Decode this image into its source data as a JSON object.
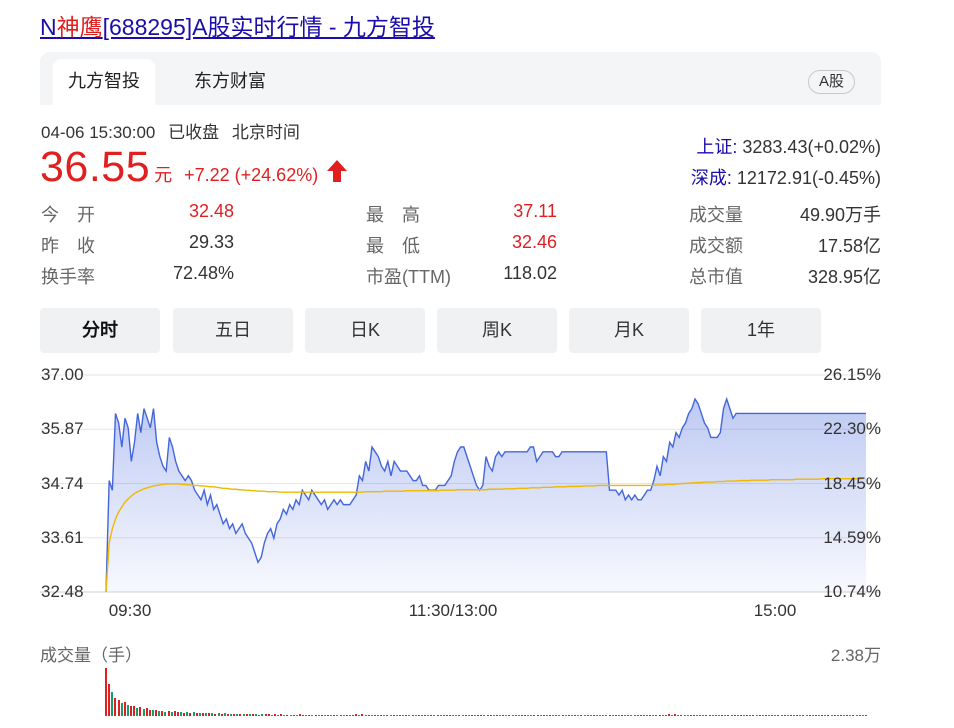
{
  "title": {
    "prefix": "N",
    "highlight": "神鹰",
    "suffix": "[688295]A股实时行情 - 九方智投"
  },
  "tabs": [
    {
      "label": "九方智投",
      "active": true
    },
    {
      "label": "东方财富",
      "active": false
    }
  ],
  "market_badge": "A股",
  "status": {
    "datetime": "04-06 15:30:00",
    "state": "已收盘",
    "timezone": "北京时间"
  },
  "quote": {
    "price": "36.55",
    "unit": "元",
    "change": "+7.22 (+24.62%)",
    "direction": "up"
  },
  "indices": [
    {
      "name": "上证:",
      "value": "3283.43(+0.02%)"
    },
    {
      "name": "深成:",
      "value": "12172.91(-0.45%)"
    }
  ],
  "stats": [
    [
      {
        "label": "今　开",
        "value": "32.48",
        "color": "red"
      },
      {
        "label": "最　高",
        "value": "37.11",
        "color": "red"
      },
      {
        "label": "成交量",
        "value": "49.90万手",
        "color": "dark"
      }
    ],
    [
      {
        "label": "昨　收",
        "value": "29.33",
        "color": "dark"
      },
      {
        "label": "最　低",
        "value": "32.46",
        "color": "red"
      },
      {
        "label": "成交额",
        "value": "17.58亿",
        "color": "dark"
      }
    ],
    [
      {
        "label": "换手率",
        "value": "72.48%",
        "color": "dark"
      },
      {
        "label": "市盈(TTM)",
        "value": "118.02",
        "color": "dark"
      },
      {
        "label": "总市值",
        "value": "328.95亿",
        "color": "dark"
      }
    ]
  ],
  "period_buttons": [
    {
      "label": "分时",
      "active": true
    },
    {
      "label": "五日",
      "active": false
    },
    {
      "label": "日K",
      "active": false
    },
    {
      "label": "周K",
      "active": false
    },
    {
      "label": "月K",
      "active": false
    },
    {
      "label": "1年",
      "active": false
    }
  ],
  "colors": {
    "up": "#e02020",
    "down": "#10a070",
    "price_line": "#4466dd",
    "avg_line": "#f0b800",
    "link": "#1a0dab"
  },
  "chart_data": {
    "type": "line",
    "y_ticks_left": [
      "37.00",
      "35.87",
      "34.74",
      "33.61",
      "32.48"
    ],
    "y_ticks_right": [
      "26.15%",
      "22.30%",
      "18.45%",
      "14.59%",
      "10.74%"
    ],
    "ylim": [
      32.48,
      37.0
    ],
    "x_ticks": [
      "09:30",
      "11:30/13:00",
      "15:00"
    ],
    "grid": true,
    "x": [
      0,
      1,
      2,
      3,
      4,
      5,
      6,
      7,
      8,
      9,
      10,
      11,
      12,
      13,
      14,
      15,
      16,
      17,
      18,
      19,
      20,
      21,
      22,
      23,
      24,
      25,
      26,
      27,
      28,
      29,
      30,
      31,
      32,
      33,
      34,
      35,
      36,
      37,
      38,
      39,
      40,
      41,
      42,
      43,
      44,
      45,
      46,
      47,
      48,
      49,
      50,
      51,
      52,
      53,
      54,
      55,
      56,
      57,
      58,
      59,
      60,
      61,
      62,
      63,
      64,
      65,
      66,
      67,
      68,
      69,
      70,
      71,
      72,
      73,
      74,
      75,
      76,
      77,
      78,
      79,
      80,
      81,
      82,
      83,
      84,
      85,
      86,
      87,
      88,
      89,
      90,
      91,
      92,
      93,
      94,
      95,
      96,
      97,
      98,
      99,
      100,
      101,
      102,
      103,
      104,
      105,
      106,
      107,
      108,
      109,
      110,
      111,
      112,
      113,
      114,
      115,
      116,
      117,
      118,
      119,
      120,
      121,
      122,
      123,
      124,
      125,
      126,
      127,
      128,
      129,
      130,
      131,
      132,
      133,
      134,
      135,
      136,
      137,
      138,
      139,
      140,
      141,
      142,
      143,
      144,
      145,
      146,
      147,
      148,
      149,
      150,
      151,
      152,
      153,
      154,
      155,
      156,
      157,
      158,
      159,
      160,
      161,
      162,
      163,
      164,
      165,
      166,
      167,
      168,
      169,
      170,
      171,
      172,
      173,
      174,
      175,
      176,
      177,
      178,
      179,
      180,
      181,
      182,
      183,
      184,
      185,
      186,
      187,
      188,
      189,
      190,
      191,
      192,
      193,
      194,
      195,
      196,
      197,
      198,
      199,
      200,
      201,
      202,
      203,
      204,
      205,
      206,
      207,
      208,
      209,
      210,
      211,
      212,
      213,
      214,
      215,
      216,
      217,
      218,
      219,
      220,
      221,
      222,
      223,
      224,
      225,
      226,
      227,
      228,
      229,
      230,
      231,
      232,
      233,
      234,
      235,
      236,
      237,
      238,
      239,
      240
    ],
    "series": [
      {
        "values": [
          32.48,
          34.8,
          34.6,
          36.2,
          36.0,
          35.5,
          36.1,
          35.9,
          35.2,
          35.6,
          36.2,
          35.8,
          36.3,
          36.1,
          35.9,
          36.3,
          35.6,
          35.3,
          35.1,
          35.0,
          35.7,
          35.5,
          35.2,
          35.0,
          34.9,
          34.8,
          34.9,
          34.8,
          34.6,
          34.5,
          34.4,
          34.6,
          34.3,
          34.5,
          34.2,
          34.3,
          34.1,
          33.9,
          34.0,
          33.8,
          33.9,
          33.7,
          33.8,
          33.9,
          33.7,
          33.6,
          33.5,
          33.3,
          33.1,
          33.2,
          33.5,
          33.7,
          33.8,
          33.6,
          33.9,
          34.0,
          34.2,
          34.1,
          34.3,
          34.2,
          34.4,
          34.3,
          34.6,
          34.5,
          34.4,
          34.6,
          34.5,
          34.4,
          34.3,
          34.4,
          34.2,
          34.3,
          34.4,
          34.3,
          34.4,
          34.3,
          34.3,
          34.3,
          34.4,
          34.5,
          34.9,
          34.8,
          35.2,
          35.0,
          35.5,
          35.4,
          35.3,
          35.1,
          35.0,
          35.2,
          34.9,
          35.2,
          35.1,
          35.0,
          35.0,
          35.0,
          34.9,
          34.8,
          34.8,
          34.9,
          34.7,
          34.7,
          34.6,
          34.6,
          34.6,
          34.7,
          34.7,
          34.7,
          34.8,
          34.9,
          35.2,
          35.4,
          35.5,
          35.5,
          35.3,
          35.1,
          34.9,
          34.7,
          34.6,
          34.7,
          35.3,
          35.1,
          35.0,
          35.3,
          35.4,
          35.3,
          35.4,
          35.4,
          35.4,
          35.4,
          35.4,
          35.4,
          35.4,
          35.4,
          35.5,
          35.5,
          35.2,
          35.3,
          35.4,
          35.4,
          35.4,
          35.4,
          35.3,
          35.3,
          35.4,
          35.4,
          35.4,
          35.4,
          35.4,
          35.4,
          35.4,
          35.4,
          35.4,
          35.4,
          35.4,
          35.4,
          35.4,
          35.4,
          35.4,
          34.6,
          34.6,
          34.6,
          34.5,
          34.6,
          34.4,
          34.5,
          34.4,
          34.5,
          34.4,
          34.4,
          34.5,
          34.6,
          34.6,
          34.8,
          35.1,
          34.9,
          35.3,
          35.2,
          35.6,
          35.5,
          35.8,
          35.7,
          35.9,
          36.0,
          36.2,
          36.3,
          36.5,
          36.4,
          36.2,
          36.0,
          35.9,
          35.7,
          35.7,
          35.7,
          35.8,
          36.3,
          36.5,
          36.3,
          36.1,
          36.2,
          36.2,
          36.2,
          36.2,
          36.2,
          36.2,
          36.2,
          36.2,
          36.2,
          36.2,
          36.2,
          36.2,
          36.2,
          36.2,
          36.2,
          36.2,
          36.2,
          36.2,
          36.2,
          36.2,
          36.2,
          36.2,
          36.2,
          36.2,
          36.2,
          36.2,
          36.2,
          36.2,
          36.2,
          36.2,
          36.2,
          36.2,
          36.2,
          36.2,
          36.2,
          36.2,
          36.2,
          36.2,
          36.2,
          36.2,
          36.2,
          36.2
        ]
      },
      {
        "values": [
          32.48,
          33.5,
          33.8,
          34.0,
          34.15,
          34.25,
          34.35,
          34.42,
          34.48,
          34.53,
          34.57,
          34.6,
          34.63,
          34.65,
          34.67,
          34.69,
          34.7,
          34.71,
          34.72,
          34.73,
          34.73,
          34.73,
          34.73,
          34.73,
          34.72,
          34.72,
          34.71,
          34.71,
          34.7,
          34.7,
          34.69,
          34.69,
          34.68,
          34.67,
          34.67,
          34.66,
          34.65,
          34.64,
          34.64,
          34.63,
          34.62,
          34.62,
          34.61,
          34.61,
          34.6,
          34.6,
          34.59,
          34.59,
          34.58,
          34.58,
          34.58,
          34.57,
          34.57,
          34.57,
          34.57,
          34.56,
          34.56,
          34.56,
          34.56,
          34.56,
          34.56,
          34.56,
          34.56,
          34.56,
          34.56,
          34.56,
          34.56,
          34.56,
          34.56,
          34.56,
          34.56,
          34.56,
          34.56,
          34.56,
          34.56,
          34.56,
          34.56,
          34.56,
          34.56,
          34.56,
          34.56,
          34.56,
          34.57,
          34.57,
          34.57,
          34.57,
          34.57,
          34.57,
          34.58,
          34.58,
          34.58,
          34.58,
          34.58,
          34.58,
          34.58,
          34.59,
          34.59,
          34.59,
          34.59,
          34.59,
          34.59,
          34.59,
          34.59,
          34.59,
          34.59,
          34.59,
          34.6,
          34.6,
          34.6,
          34.6,
          34.6,
          34.61,
          34.61,
          34.61,
          34.61,
          34.61,
          34.61,
          34.61,
          34.61,
          34.61,
          34.61,
          34.62,
          34.62,
          34.62,
          34.62,
          34.62,
          34.63,
          34.63,
          34.63,
          34.63,
          34.64,
          34.64,
          34.64,
          34.64,
          34.65,
          34.65,
          34.65,
          34.65,
          34.66,
          34.66,
          34.66,
          34.66,
          34.67,
          34.67,
          34.67,
          34.67,
          34.68,
          34.68,
          34.68,
          34.68,
          34.68,
          34.69,
          34.69,
          34.69,
          34.69,
          34.7,
          34.7,
          34.7,
          34.7,
          34.7,
          34.7,
          34.7,
          34.7,
          34.7,
          34.7,
          34.7,
          34.7,
          34.7,
          34.7,
          34.7,
          34.7,
          34.7,
          34.7,
          34.7,
          34.71,
          34.71,
          34.71,
          34.72,
          34.72,
          34.72,
          34.73,
          34.73,
          34.74,
          34.74,
          34.75,
          34.75,
          34.76,
          34.76,
          34.76,
          34.77,
          34.77,
          34.77,
          34.77,
          34.78,
          34.78,
          34.78,
          34.79,
          34.79,
          34.79,
          34.79,
          34.8,
          34.8,
          34.8,
          34.8,
          34.81,
          34.81,
          34.81,
          34.81,
          34.81,
          34.81,
          34.82,
          34.82,
          34.82,
          34.82,
          34.82,
          34.82,
          34.82,
          34.82,
          34.83,
          34.83,
          34.83,
          34.83,
          34.83,
          34.83,
          34.83,
          34.83,
          34.84,
          34.84,
          34.84,
          34.84,
          34.84,
          34.84,
          34.84,
          34.84,
          34.84,
          34.84,
          34.84,
          34.84,
          34.84,
          34.84
        ]
      }
    ],
    "volume": {
      "ylabel": "成交量（手）",
      "max_label": "2.38万",
      "values": [
        23800,
        16000,
        12000,
        9000,
        8000,
        6500,
        7000,
        5500,
        5000,
        4800,
        4000,
        4300,
        3500,
        3800,
        3000,
        3200,
        2800,
        2600,
        2700,
        2200,
        2500,
        2000,
        2300,
        1800,
        2100,
        1700,
        1900,
        1600,
        1800,
        1500,
        1700,
        1400,
        1600,
        1300,
        1500,
        1200,
        1400,
        1100,
        1300,
        1000,
        1200,
        900,
        1100,
        800,
        1000,
        900,
        1000,
        800,
        900,
        700,
        1100,
        900,
        800,
        700,
        900,
        600,
        800,
        600,
        700,
        500,
        700,
        600,
        800,
        500,
        600,
        500,
        700,
        500,
        600,
        400,
        600,
        500,
        700,
        500,
        600,
        400,
        500,
        400,
        600,
        500,
        900,
        700,
        800,
        600,
        700,
        600,
        500,
        600,
        500,
        600,
        500,
        400,
        500,
        400,
        500,
        400,
        500,
        400,
        400,
        500,
        400,
        400,
        300,
        400,
        300,
        400,
        500,
        400,
        500,
        600,
        700,
        600,
        500,
        400,
        500,
        400,
        500,
        600,
        400,
        500,
        600,
        500,
        400,
        500,
        400,
        500,
        400,
        400,
        400,
        400,
        400,
        300,
        400,
        300,
        400,
        500,
        400,
        300,
        400,
        300,
        300,
        300,
        300,
        300,
        300,
        300,
        300,
        300,
        300,
        300,
        300,
        300,
        300,
        400,
        400,
        300,
        300,
        400,
        500,
        400,
        500,
        300,
        400,
        300,
        400,
        300,
        400,
        300,
        300,
        400,
        400,
        500,
        600,
        500,
        600,
        500,
        700,
        500,
        600,
        700,
        800,
        700,
        900,
        600,
        500,
        600,
        500,
        400,
        500,
        600,
        500,
        600,
        700,
        500,
        400,
        300,
        300,
        300,
        300,
        300,
        300,
        300,
        300,
        300,
        300,
        300,
        300,
        300,
        300,
        300,
        300,
        300,
        300,
        300,
        300,
        300,
        300,
        300,
        300,
        300,
        300,
        300,
        300,
        300,
        300,
        300,
        300,
        300,
        300,
        300,
        300,
        300,
        300,
        300,
        300,
        300,
        300,
        300,
        300,
        300,
        300,
        300,
        300,
        300
      ],
      "colors": [
        "up",
        "up",
        "down",
        "up",
        "up",
        "down",
        "up",
        "down",
        "up",
        "up",
        "down",
        "up",
        "down",
        "up",
        "up",
        "down",
        "up",
        "down",
        "up",
        "down",
        "up",
        "down",
        "up",
        "up",
        "down",
        "up",
        "down",
        "up",
        "down",
        "up",
        "down",
        "up",
        "down",
        "up",
        "down",
        "up",
        "down",
        "up",
        "down",
        "up",
        "down",
        "up",
        "down",
        "up",
        "down",
        "up",
        "down",
        "up",
        "down",
        "up",
        "down",
        "up",
        "up",
        "down",
        "up",
        "down",
        "up",
        "down",
        "up",
        "down",
        "up",
        "down",
        "up",
        "up",
        "down",
        "up",
        "down",
        "up",
        "down",
        "up",
        "down",
        "up",
        "down",
        "up",
        "down",
        "up",
        "down",
        "up",
        "down",
        "up",
        "up",
        "down",
        "up",
        "down",
        "up",
        "down",
        "up",
        "down",
        "up",
        "down",
        "up",
        "down",
        "up",
        "down",
        "up",
        "down",
        "up",
        "down",
        "up",
        "down",
        "up",
        "down",
        "up",
        "down",
        "up",
        "down",
        "up",
        "down",
        "up",
        "up",
        "up",
        "down",
        "down",
        "up",
        "down",
        "up",
        "down",
        "up",
        "down",
        "up",
        "up",
        "down",
        "up",
        "up",
        "down",
        "up",
        "down",
        "up",
        "down",
        "up",
        "down",
        "up",
        "down",
        "up",
        "up",
        "down",
        "down",
        "up",
        "up",
        "down",
        "up",
        "down",
        "up",
        "down",
        "up",
        "down",
        "up",
        "down",
        "up",
        "down",
        "up",
        "down",
        "up",
        "down",
        "up",
        "down",
        "up",
        "down",
        "down",
        "down",
        "down",
        "up",
        "down",
        "up",
        "down",
        "up",
        "down",
        "up",
        "down",
        "up",
        "up",
        "up",
        "up",
        "down",
        "up",
        "down",
        "up",
        "up",
        "down",
        "up",
        "up",
        "down",
        "up",
        "down",
        "up",
        "down",
        "down",
        "up",
        "up",
        "down",
        "up",
        "down",
        "up",
        "up",
        "down",
        "up",
        "down",
        "up",
        "down",
        "up",
        "down",
        "up",
        "down",
        "up",
        "down",
        "up",
        "down",
        "up",
        "down",
        "up",
        "down",
        "up",
        "down",
        "up",
        "down",
        "up",
        "down",
        "up",
        "down",
        "up",
        "down",
        "up",
        "down",
        "up",
        "down",
        "up",
        "down",
        "up",
        "down",
        "up",
        "down",
        "up",
        "down",
        "up",
        "down",
        "up",
        "down",
        "up",
        "down",
        "up",
        "down",
        "up",
        "down",
        "up"
      ]
    }
  }
}
